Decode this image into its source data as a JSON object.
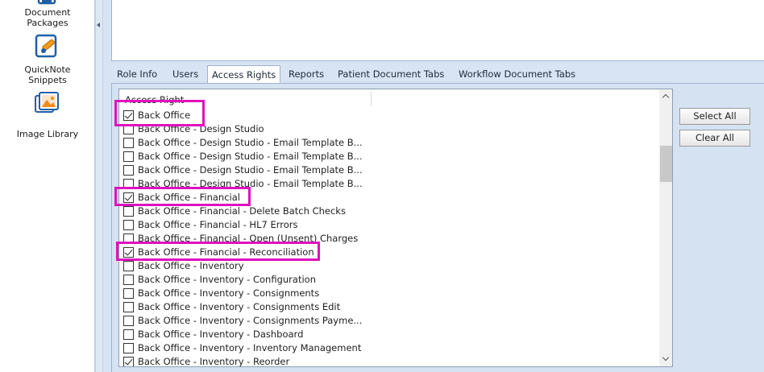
{
  "sidebar": {
    "items": [
      {
        "label_line1": "Document",
        "label_line2": "Packages",
        "icon": "document-packages-icon"
      },
      {
        "label_line1": "QuickNote",
        "label_line2": "Snippets",
        "icon": "quicknote-snippets-icon"
      },
      {
        "label_line1": "Image Library",
        "label_line2": "",
        "icon": "image-library-icon"
      }
    ]
  },
  "tabs": [
    {
      "label": "Role Info"
    },
    {
      "label": "Users"
    },
    {
      "label": "Access Rights",
      "active": true
    },
    {
      "label": "Reports"
    },
    {
      "label": "Patient Document Tabs"
    },
    {
      "label": "Workflow Document Tabs"
    }
  ],
  "list": {
    "header": "Access Right",
    "rows": [
      {
        "label": "Back Office",
        "checked": true
      },
      {
        "label": "Back Office - Design Studio",
        "checked": false
      },
      {
        "label": "Back Office - Design Studio - Email Template B...",
        "checked": false
      },
      {
        "label": "Back Office - Design Studio - Email Template B...",
        "checked": false
      },
      {
        "label": "Back Office - Design Studio - Email Template B...",
        "checked": false
      },
      {
        "label": "Back Office - Design Studio - Email Template B...",
        "checked": false
      },
      {
        "label": "Back Office - Financial",
        "checked": true
      },
      {
        "label": "Back Office - Financial - Delete Batch Checks",
        "checked": false
      },
      {
        "label": "Back Office - Financial - HL7 Errors",
        "checked": false
      },
      {
        "label": "Back Office - Financial - Open (Unsent) Charges",
        "checked": false
      },
      {
        "label": "Back Office - Financial - Reconciliation",
        "checked": true
      },
      {
        "label": "Back Office - Inventory",
        "checked": false
      },
      {
        "label": "Back Office - Inventory - Configuration",
        "checked": false
      },
      {
        "label": "Back Office - Inventory - Consignments",
        "checked": false
      },
      {
        "label": "Back Office - Inventory - Consignments Edit",
        "checked": false
      },
      {
        "label": "Back Office - Inventory - Consignments Payme...",
        "checked": false
      },
      {
        "label": "Back Office - Inventory - Dashboard",
        "checked": false
      },
      {
        "label": "Back Office - Inventory - Inventory Management",
        "checked": false
      },
      {
        "label": "Back Office - Inventory - Reorder",
        "checked": true
      }
    ]
  },
  "buttons": {
    "select_all": "Select All",
    "clear_all": "Clear All"
  },
  "colors": {
    "highlight": "#e010c0",
    "panel_bg": "#d5e2f2",
    "border": "#9fb3cc"
  }
}
